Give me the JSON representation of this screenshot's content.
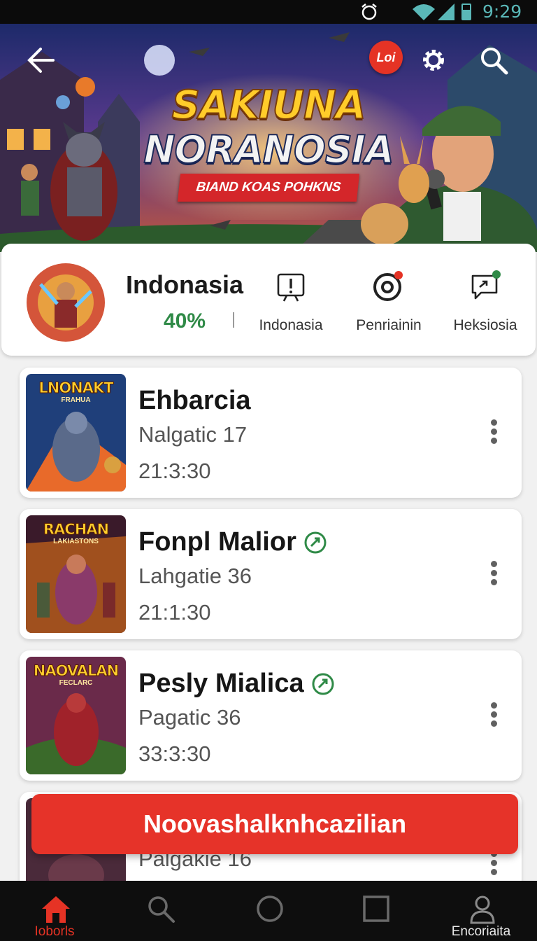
{
  "status_bar": {
    "time": "9:29"
  },
  "banner": {
    "title_line1": "SAKIUNA",
    "title_line2": "NORANOSIA",
    "ribbon": "BIAND KOAS POHKNS",
    "badge": "Loi"
  },
  "profile": {
    "name": "Indonasia",
    "percent": "40%",
    "stats": [
      {
        "label": "Indonasia",
        "icon": "alert-box-icon"
      },
      {
        "label": "Penriainin",
        "icon": "target-icon"
      },
      {
        "label": "Heksiosia",
        "icon": "share-message-icon"
      }
    ]
  },
  "games": [
    {
      "title": "Ehbarcia",
      "subtitle": "Nalgatic 17",
      "time": "21:3:30",
      "verified": false,
      "thumb_caption": "LNONAKT",
      "thumb_sub": "FRAHUA"
    },
    {
      "title": "Fonpl Malior",
      "subtitle": "Lahgatie 36",
      "time": "21:1:30",
      "verified": true,
      "thumb_caption": "RACHAN",
      "thumb_sub": "LAKIASTONS"
    },
    {
      "title": "Pesly Mialica",
      "subtitle": "Pagatic 36",
      "time": "33:3:30",
      "verified": true,
      "thumb_caption": "NAOVALAN",
      "thumb_sub": "FECLARC"
    },
    {
      "title": "",
      "subtitle": "Palgakie 16",
      "time": "",
      "verified": false,
      "thumb_caption": "",
      "thumb_sub": ""
    }
  ],
  "toast": {
    "text": "Noovashalknhcazilian"
  },
  "bottom_nav": [
    {
      "label": "Ioborls",
      "icon": "home-icon",
      "active": true
    },
    {
      "label": "",
      "icon": "search-icon",
      "active": false
    },
    {
      "label": "",
      "icon": "circle-icon",
      "active": false
    },
    {
      "label": "",
      "icon": "square-icon",
      "active": false
    },
    {
      "label": "Encoriaita",
      "icon": "person-icon",
      "active": false
    }
  ],
  "colors": {
    "accent_red": "#e53325",
    "green": "#2f8a47"
  }
}
